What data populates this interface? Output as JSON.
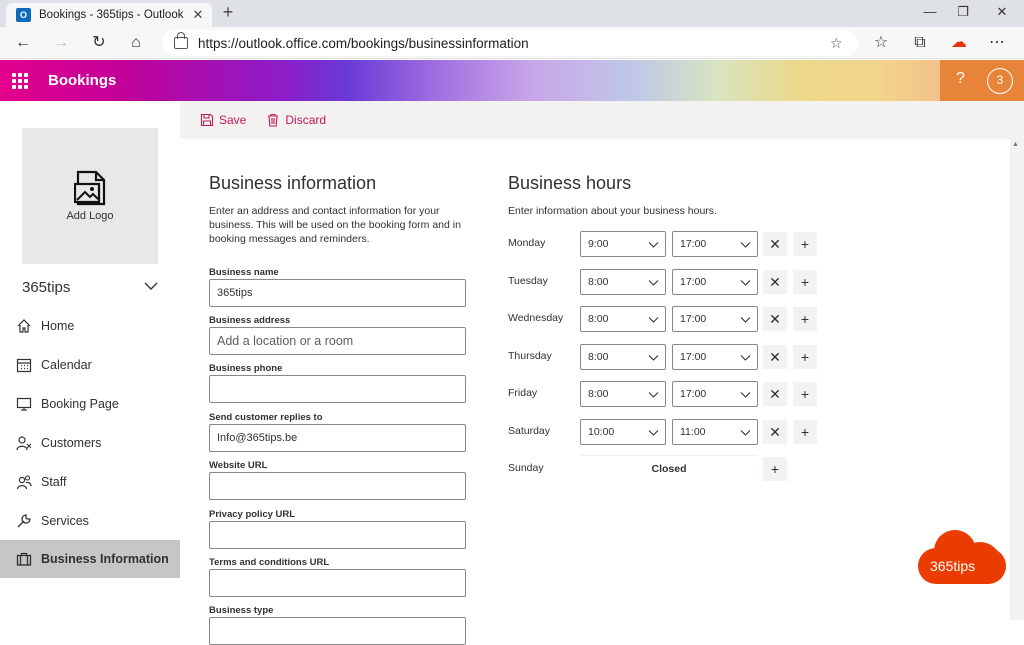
{
  "browser": {
    "tab_title": "Bookings - 365tips - Outlook",
    "url": "https://outlook.office.com/bookings/businessinformation"
  },
  "app": {
    "name": "Bookings",
    "help_label": "?",
    "badge_count": "3"
  },
  "sidebar": {
    "add_logo": "Add Logo",
    "business_name": "365tips",
    "items": [
      {
        "label": "Home",
        "icon": "home-icon"
      },
      {
        "label": "Calendar",
        "icon": "calendar-icon"
      },
      {
        "label": "Booking Page",
        "icon": "monitor-icon"
      },
      {
        "label": "Customers",
        "icon": "customers-icon"
      },
      {
        "label": "Staff",
        "icon": "staff-icon"
      },
      {
        "label": "Services",
        "icon": "wrench-icon"
      },
      {
        "label": "Business Information",
        "icon": "briefcase-icon",
        "active": true
      }
    ]
  },
  "toolbar": {
    "save_label": "Save",
    "discard_label": "Discard"
  },
  "business_info": {
    "title": "Business information",
    "description": "Enter an address and contact information for your business. This will be used on the booking form and in booking messages and reminders.",
    "fields": {
      "name": {
        "label": "Business name",
        "value": "365tips"
      },
      "address": {
        "label": "Business address",
        "placeholder": "Add a location or a room"
      },
      "phone": {
        "label": "Business phone",
        "value": ""
      },
      "replies": {
        "label": "Send customer replies to",
        "value": "Info@365tips.be"
      },
      "website": {
        "label": "Website URL",
        "value": ""
      },
      "privacy": {
        "label": "Privacy policy URL",
        "value": ""
      },
      "terms": {
        "label": "Terms and conditions URL",
        "value": ""
      },
      "type": {
        "label": "Business type"
      }
    }
  },
  "business_hours": {
    "title": "Business hours",
    "description": "Enter information about your business hours.",
    "days": [
      {
        "day": "Monday",
        "start": "9:00",
        "end": "17:00"
      },
      {
        "day": "Tuesday",
        "start": "8:00",
        "end": "17:00"
      },
      {
        "day": "Wednesday",
        "start": "8:00",
        "end": "17:00"
      },
      {
        "day": "Thursday",
        "start": "8:00",
        "end": "17:00"
      },
      {
        "day": "Friday",
        "start": "8:00",
        "end": "17:00"
      },
      {
        "day": "Saturday",
        "start": "10:00",
        "end": "11:00"
      }
    ],
    "sunday": {
      "day": "Sunday",
      "status": "Closed"
    },
    "remove_glyph": "✕",
    "add_glyph": "+"
  },
  "watermark": {
    "text": "365tips"
  },
  "colors": {
    "accent": "#c2185b",
    "active_nav": "#c8c6c4",
    "watermark": "#eb3c00"
  }
}
